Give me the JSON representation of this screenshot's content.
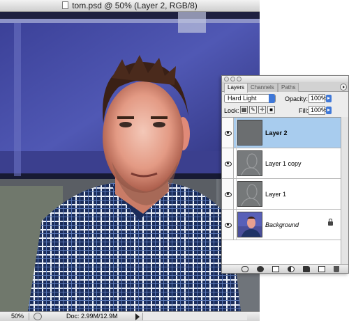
{
  "document": {
    "title": "tom.psd @ 50% (Layer 2, RGB/8)",
    "zoom": "50%",
    "doc_size": "Doc: 2.99M/12.9M"
  },
  "layers_palette": {
    "tabs": [
      "Layers",
      "Channels",
      "Paths"
    ],
    "blend_mode": "Hard Light",
    "opacity_label": "Opacity:",
    "opacity": "100%",
    "lock_label": "Lock:",
    "fill_label": "Fill:",
    "fill": "100%",
    "layers": [
      {
        "name": "Layer 2",
        "selected": true
      },
      {
        "name": "Layer 1 copy",
        "selected": false
      },
      {
        "name": "Layer 1",
        "selected": false
      },
      {
        "name": "Background",
        "selected": false,
        "locked": true
      }
    ]
  },
  "colors": {
    "selection": "#a8ccee",
    "accent": "#3f78d8"
  }
}
